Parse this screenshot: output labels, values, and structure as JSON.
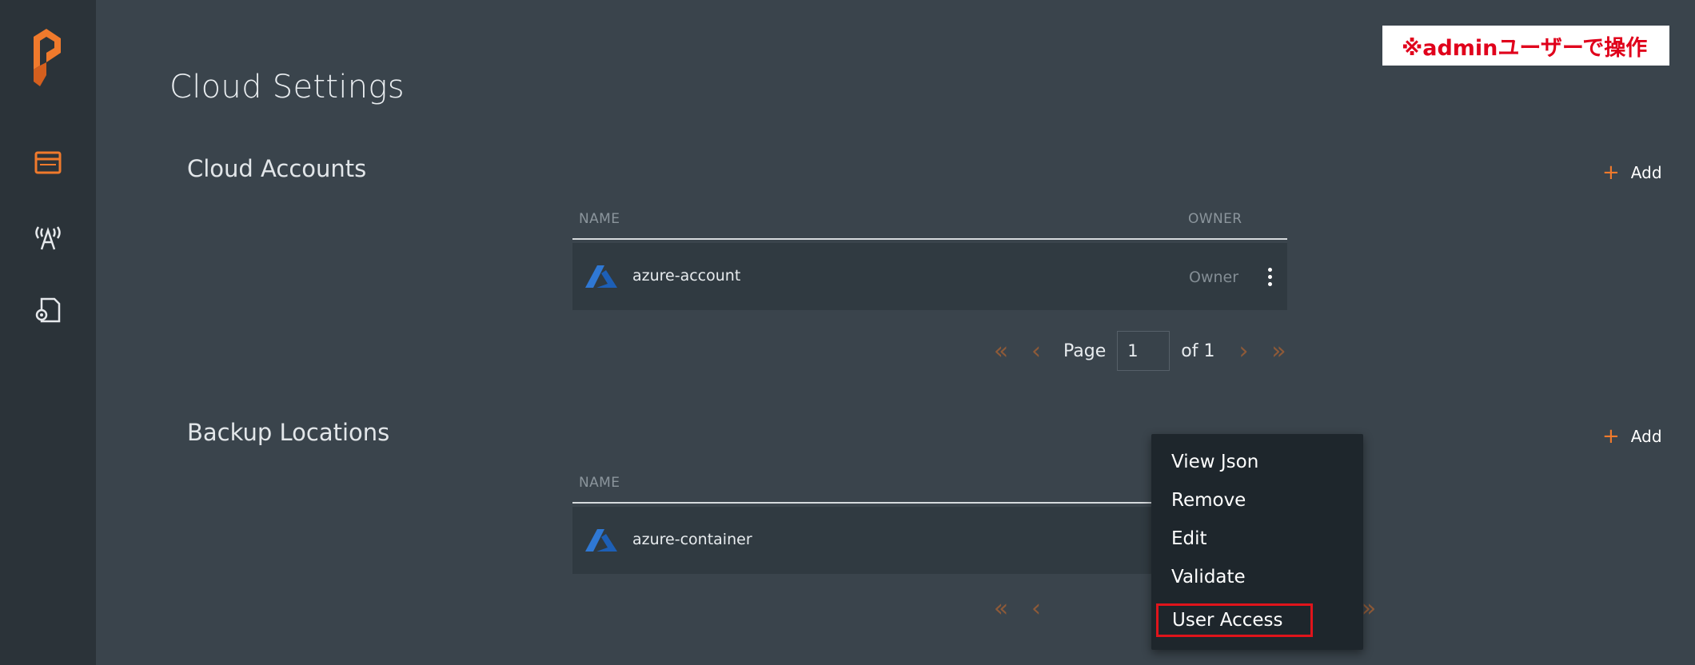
{
  "annotation": "※adminユーザーで操作",
  "page_title": "Cloud Settings",
  "colors": {
    "accent": "#f07a2c",
    "highlight": "#e0141b",
    "azure": "#2f78d4"
  },
  "sidebar": {
    "icons": [
      "portworx-logo-icon",
      "dashboard-icon",
      "antenna-icon",
      "settings-document-icon"
    ]
  },
  "cloud_accounts": {
    "title": "Cloud Accounts",
    "add_label": "Add",
    "columns": {
      "name": "NAME",
      "owner": "OWNER"
    },
    "rows": [
      {
        "name": "azure-account",
        "owner": "Owner"
      }
    ],
    "pagination": {
      "page_label": "Page",
      "page_value": "1",
      "of_label": "of 1"
    }
  },
  "backup_locations": {
    "title": "Backup Locations",
    "add_label": "Add",
    "columns": {
      "name": "NAME"
    },
    "rows": [
      {
        "name": "azure-container"
      }
    ]
  },
  "context_menu": {
    "items": [
      "View Json",
      "Remove",
      "Edit",
      "Validate",
      "User Access"
    ]
  }
}
